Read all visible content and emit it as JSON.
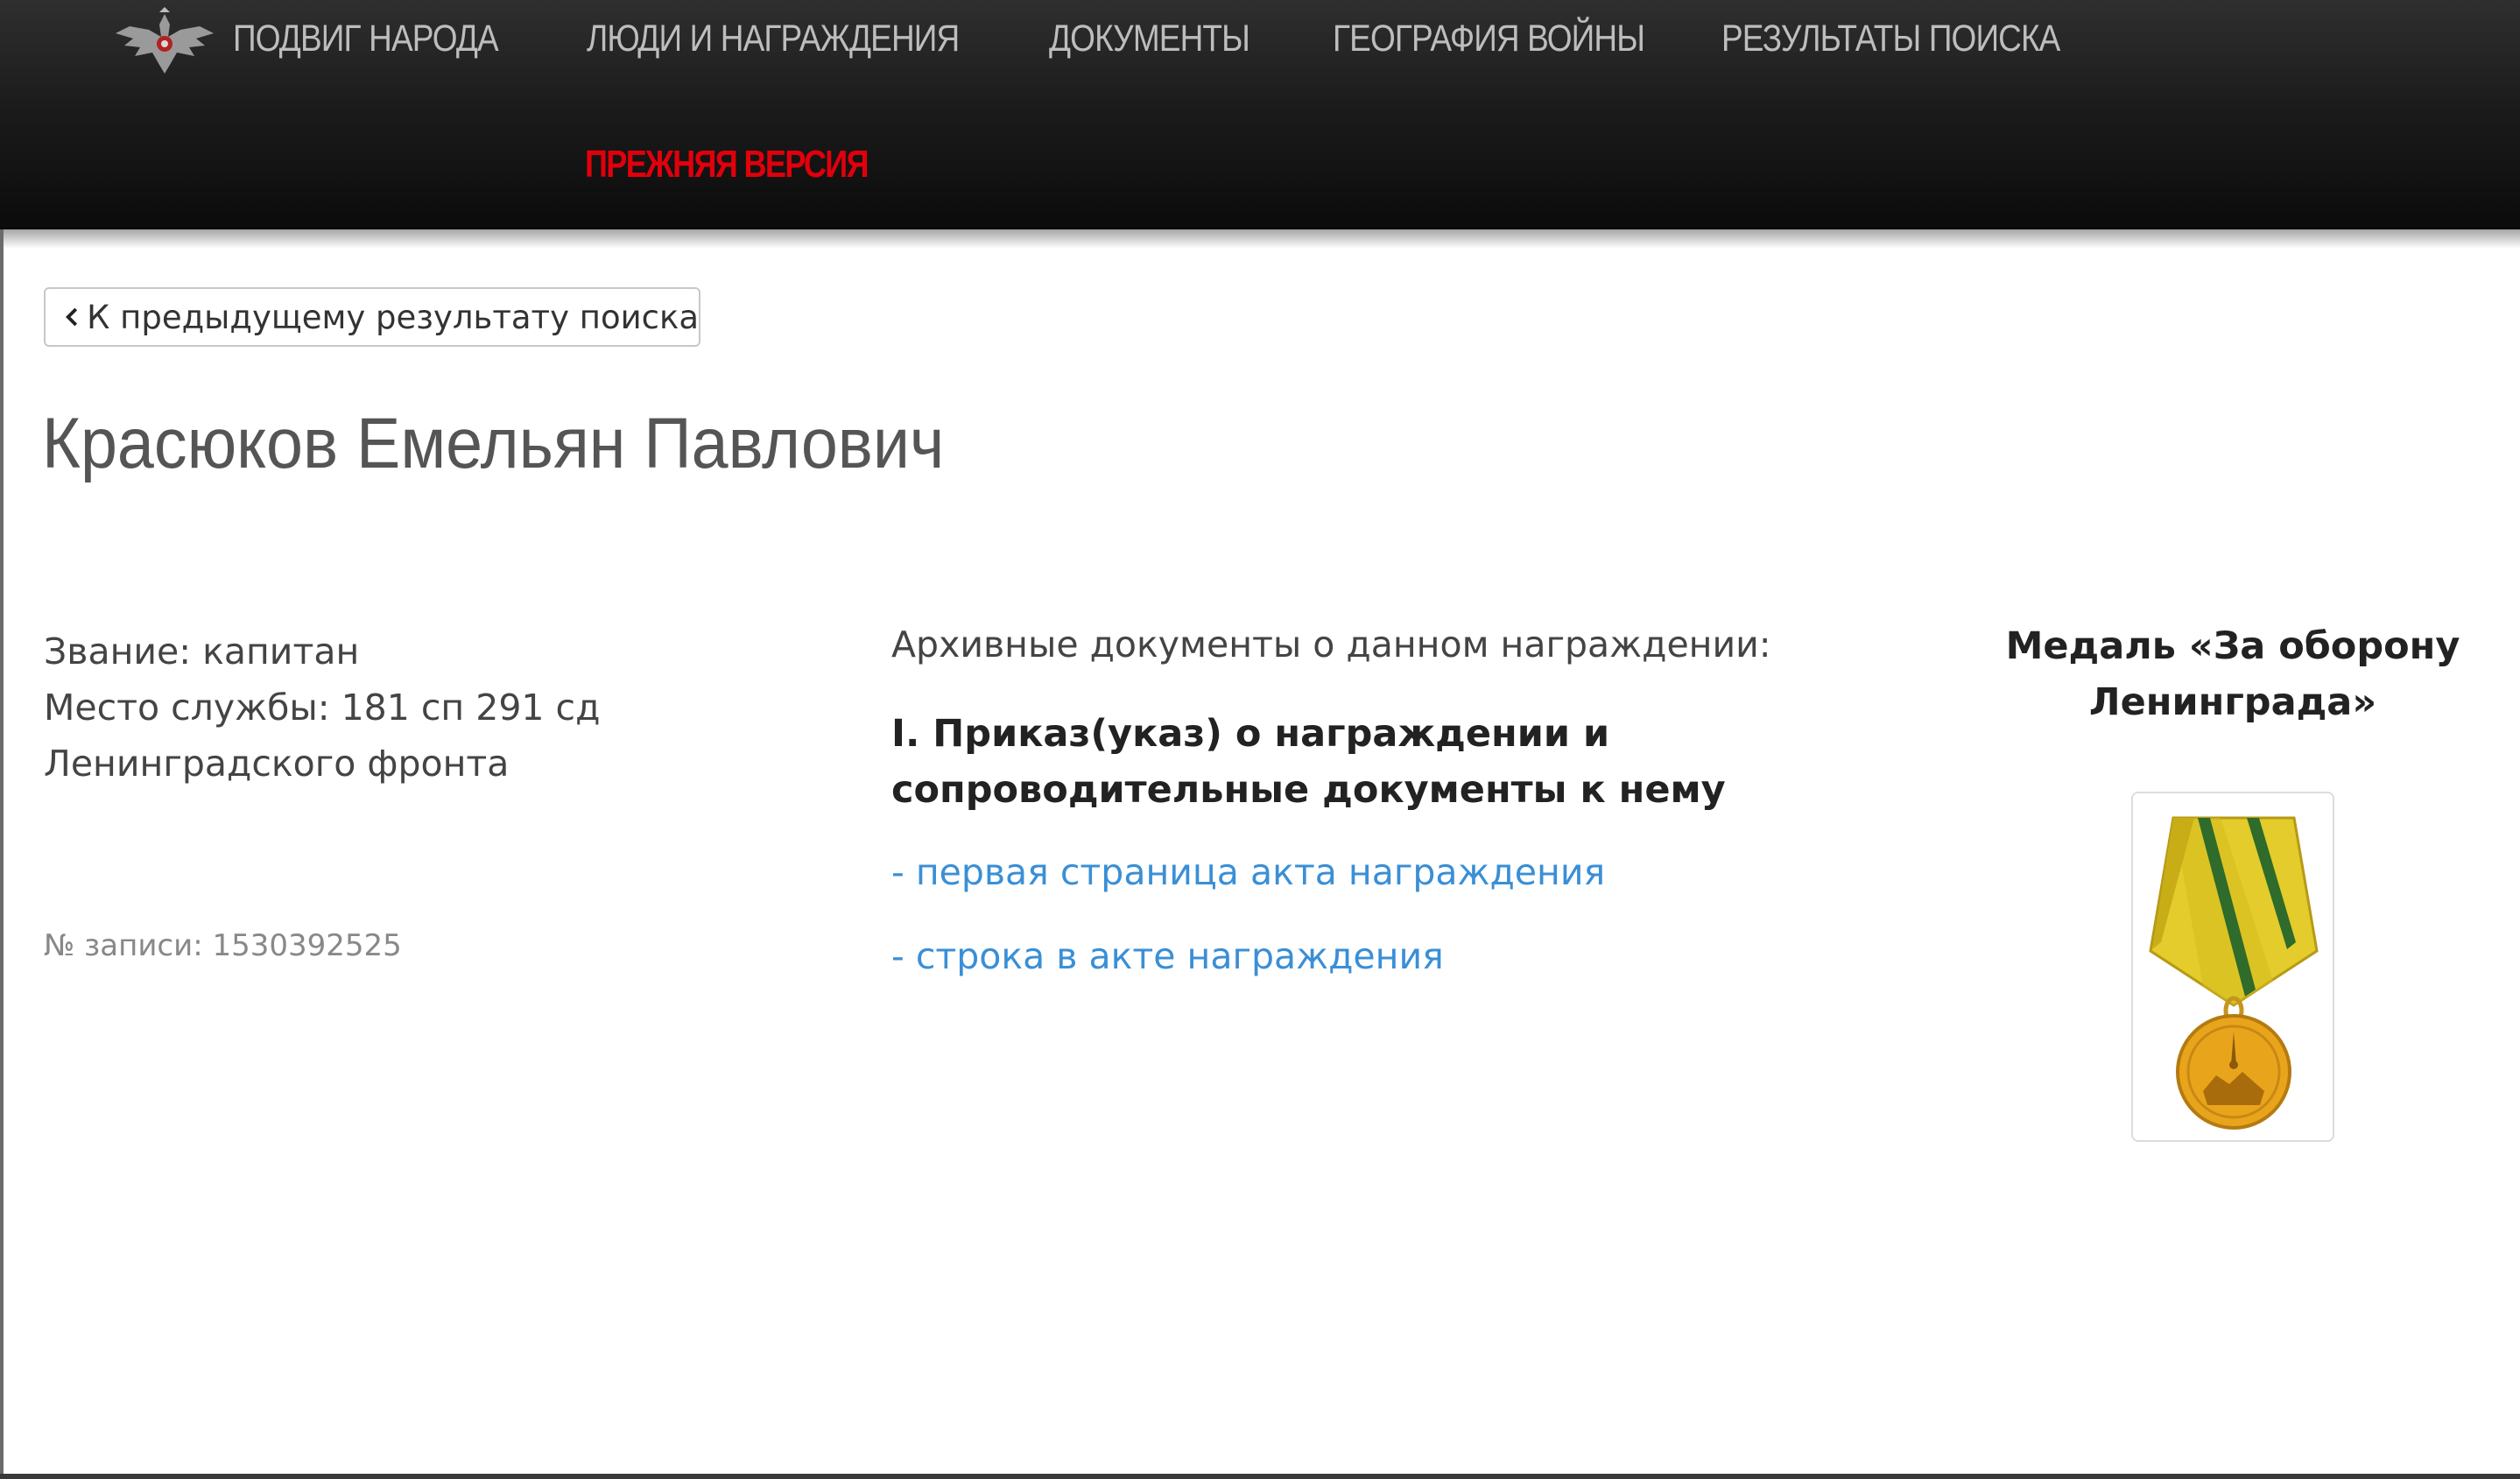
{
  "nav": {
    "items": [
      {
        "label": "ПОДВИГ НАРОДА"
      },
      {
        "label": "ЛЮДИ И НАГРАЖДЕНИЯ"
      },
      {
        "label": "ДОКУМЕНТЫ"
      },
      {
        "label": "ГЕОГРАФИЯ ВОЙНЫ"
      },
      {
        "label": "РЕЗУЛЬТАТЫ ПОИСКА"
      }
    ],
    "old_version": "ПРЕЖНЯЯ ВЕРСИЯ"
  },
  "back_button": {
    "label": "К предыдущему результату поиска",
    "icon": "chevron-left-icon"
  },
  "person": {
    "name": "Красюков Емельян Павлович",
    "rank": "Звание: капитан",
    "service_line1": "Место службы: 181 сп 291 сд",
    "service_line2": "Ленинградского фронта",
    "record_no": "№ записи: 1530392525"
  },
  "documents": {
    "heading": "Архивные документы о данном награждении:",
    "section_line1": "I. Приказ(указ) о награждении и",
    "section_line2": "сопроводительные документы к нему",
    "links": [
      {
        "label": "- первая страница акта награждения"
      },
      {
        "label": "- строка в акте награждения"
      }
    ]
  },
  "award": {
    "title_line1": "Медаль «За оборону",
    "title_line2": "Ленинграда»",
    "icon": "medal-icon"
  },
  "colors": {
    "header_bg": "#1a1a1a",
    "nav_text": "#bdbdbd",
    "old_version": "#e0000b",
    "link": "#3a8fd6"
  }
}
